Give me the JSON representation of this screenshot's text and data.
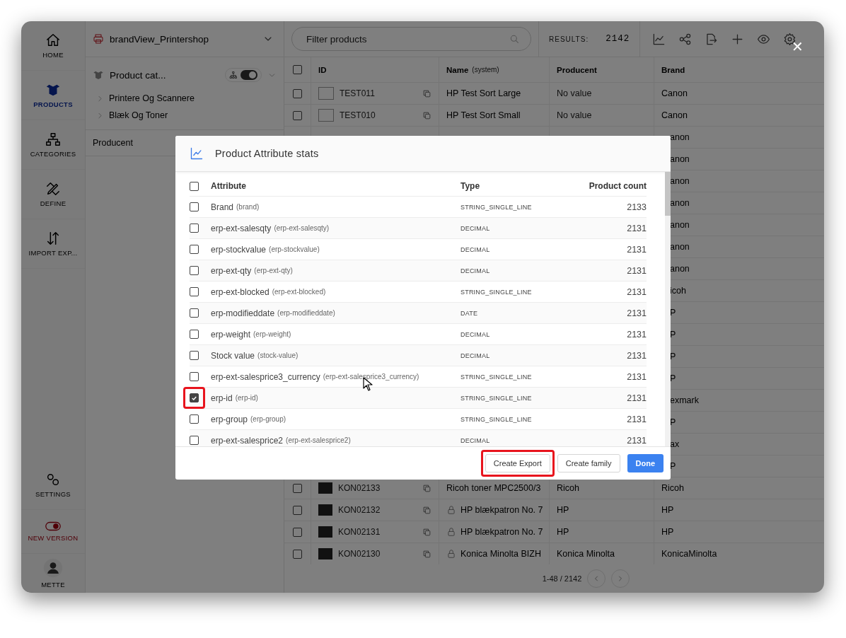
{
  "nav": {
    "items": [
      {
        "kind": "home",
        "label": "HOME",
        "selected": false
      },
      {
        "kind": "products",
        "label": "PRODUCTS",
        "selected": true
      },
      {
        "kind": "categories",
        "label": "CATEGORIES",
        "selected": false
      },
      {
        "kind": "define",
        "label": "DEFINE",
        "selected": false
      },
      {
        "kind": "import",
        "label": "IMPORT EXP...",
        "selected": false
      }
    ],
    "bottom_items": [
      {
        "kind": "settings",
        "label": "SETTINGS"
      },
      {
        "kind": "new_version",
        "label": "NEW VERSION"
      },
      {
        "kind": "user",
        "label": "METTE"
      }
    ]
  },
  "category_panel": {
    "catalog": "brandView_Printershop",
    "tree_title": "Product cat...",
    "tree_toggle_on": true,
    "tree": [
      {
        "label": "Printere Og Scannere"
      },
      {
        "label": "Blæk Og Toner"
      }
    ],
    "filter_label": "Producent"
  },
  "toolbar": {
    "filter_placeholder": "Filter products",
    "results_label": "RESULTS:",
    "results_count": "2142",
    "actions": [
      {
        "kind": "chart"
      },
      {
        "kind": "share"
      },
      {
        "kind": "export"
      },
      {
        "kind": "add"
      },
      {
        "kind": "view"
      },
      {
        "kind": "settings"
      }
    ]
  },
  "table": {
    "all_checked": false,
    "columns": [
      {
        "label": "ID"
      },
      {
        "label": "Name",
        "note": "(system)"
      },
      {
        "label": "Producent"
      },
      {
        "label": "Brand"
      }
    ],
    "rows": [
      {
        "kind": "full",
        "checked": false,
        "has_photo": false,
        "id": "TEST011",
        "locked": false,
        "name": "HP Test Sort Large",
        "producent": "No value",
        "producent_missing": true,
        "brand": "Canon"
      },
      {
        "kind": "full",
        "checked": false,
        "has_photo": false,
        "id": "TEST010",
        "locked": false,
        "name": "HP Test Sort Small",
        "producent": "No value",
        "producent_missing": true,
        "brand": "Canon"
      },
      {
        "kind": "covered",
        "brand": "anon"
      },
      {
        "kind": "covered",
        "brand": "anon"
      },
      {
        "kind": "covered",
        "brand": "anon"
      },
      {
        "kind": "covered",
        "brand": "anon"
      },
      {
        "kind": "covered",
        "brand": "anon"
      },
      {
        "kind": "covered",
        "brand": "anon"
      },
      {
        "kind": "covered",
        "brand": "anon"
      },
      {
        "kind": "covered",
        "brand": "icoh"
      },
      {
        "kind": "covered",
        "brand": "P"
      },
      {
        "kind": "covered",
        "brand": "P"
      },
      {
        "kind": "covered",
        "brand": "P"
      },
      {
        "kind": "covered",
        "brand": "P"
      },
      {
        "kind": "covered",
        "brand": "exmark"
      },
      {
        "kind": "covered",
        "brand": "P"
      },
      {
        "kind": "covered",
        "brand": "ax"
      },
      {
        "kind": "covered",
        "brand": "P"
      },
      {
        "kind": "full",
        "checked": false,
        "has_photo": true,
        "id": "KON02133",
        "locked": false,
        "name": "Ricoh toner MPC2500/3",
        "producent": "Ricoh",
        "producent_missing": false,
        "brand": "Ricoh"
      },
      {
        "kind": "full",
        "checked": false,
        "has_photo": true,
        "id": "KON02132",
        "locked": true,
        "name": "HP blækpatron No. 7",
        "producent": "HP",
        "producent_missing": false,
        "brand": "HP"
      },
      {
        "kind": "full",
        "checked": false,
        "has_photo": true,
        "id": "KON02131",
        "locked": true,
        "name": "HP blækpatron No. 7",
        "producent": "HP",
        "producent_missing": false,
        "brand": "HP"
      },
      {
        "kind": "full",
        "checked": false,
        "has_photo": true,
        "id": "KON02130",
        "locked": true,
        "name": "Konica Minolta BIZH",
        "producent": "Konica Minolta",
        "producent_missing": false,
        "brand": "KonicaMinolta"
      }
    ],
    "pagination": {
      "range": "1-48 / 2142"
    }
  },
  "close_button": {
    "label": "✕"
  },
  "modal": {
    "title": "Product Attribute stats",
    "all_checked": false,
    "columns": {
      "attribute": "Attribute",
      "type": "Type",
      "count": "Product count"
    },
    "rows": [
      {
        "name": "Brand",
        "key": "(brand)",
        "type": "STRING_SINGLE_LINE",
        "count": "2133",
        "checked": false,
        "highlighted": false
      },
      {
        "name": "erp-ext-salesqty",
        "key": "(erp-ext-salesqty)",
        "type": "DECIMAL",
        "count": "2131",
        "checked": false,
        "highlighted": false
      },
      {
        "name": "erp-stockvalue",
        "key": "(erp-stockvalue)",
        "type": "DECIMAL",
        "count": "2131",
        "checked": false,
        "highlighted": false
      },
      {
        "name": "erp-ext-qty",
        "key": "(erp-ext-qty)",
        "type": "DECIMAL",
        "count": "2131",
        "checked": false,
        "highlighted": false
      },
      {
        "name": "erp-ext-blocked",
        "key": "(erp-ext-blocked)",
        "type": "STRING_SINGLE_LINE",
        "count": "2131",
        "checked": false,
        "highlighted": false
      },
      {
        "name": "erp-modifieddate",
        "key": "(erp-modifieddate)",
        "type": "DATE",
        "count": "2131",
        "checked": false,
        "highlighted": false
      },
      {
        "name": "erp-weight",
        "key": "(erp-weight)",
        "type": "DECIMAL",
        "count": "2131",
        "checked": false,
        "highlighted": false
      },
      {
        "name": "Stock value",
        "key": "(stock-value)",
        "type": "DECIMAL",
        "count": "2131",
        "checked": false,
        "highlighted": false
      },
      {
        "name": "erp-ext-salesprice3_currency",
        "key": "(erp-ext-salesprice3_currency)",
        "type": "STRING_SINGLE_LINE",
        "count": "2131",
        "checked": false,
        "highlighted": false
      },
      {
        "name": "erp-id",
        "key": "(erp-id)",
        "type": "STRING_SINGLE_LINE",
        "count": "2131",
        "checked": true,
        "highlighted": true
      },
      {
        "name": "erp-group",
        "key": "(erp-group)",
        "type": "STRING_SINGLE_LINE",
        "count": "2131",
        "checked": false,
        "highlighted": false
      },
      {
        "name": "erp-ext-salesprice2",
        "key": "(erp-ext-salesprice2)",
        "type": "DECIMAL",
        "count": "2131",
        "checked": false,
        "highlighted": false
      }
    ],
    "buttons": [
      {
        "label": "Create Export",
        "kind": "secondary",
        "highlighted": true
      },
      {
        "label": "Create family",
        "kind": "secondary",
        "highlighted": false
      },
      {
        "label": "Done",
        "kind": "primary",
        "highlighted": false
      }
    ]
  }
}
